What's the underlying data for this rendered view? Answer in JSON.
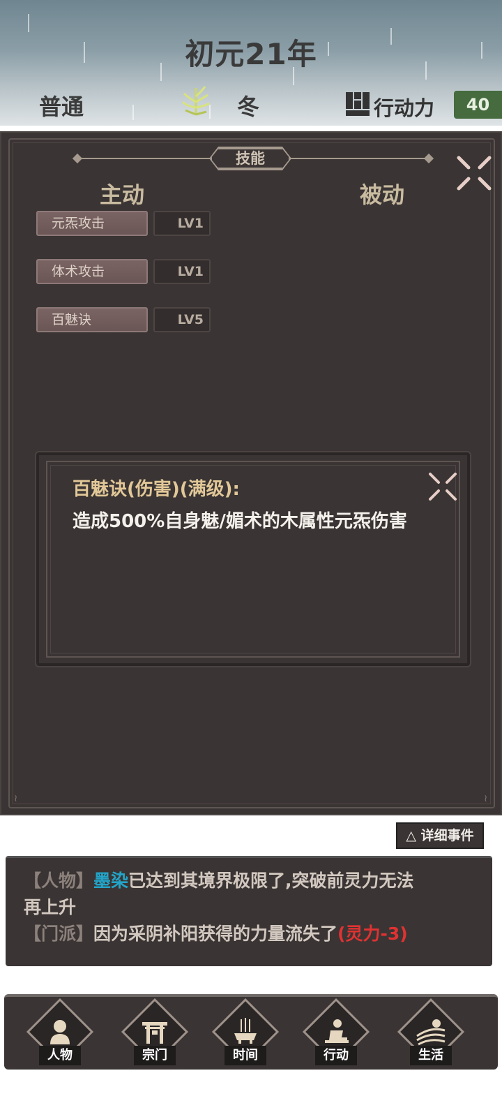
{
  "header": {
    "year": "初元21年",
    "difficulty": "普通",
    "season_icon": "reed-icon",
    "season": "冬",
    "action_points_label": "行动力",
    "action_points_value": "40"
  },
  "skills": {
    "tab_title": "技能",
    "active_heading": "主动",
    "passive_heading": "被动",
    "active_list": [
      {
        "name": "元炁攻击",
        "level": "LV1"
      },
      {
        "name": "体术攻击",
        "level": "LV1"
      },
      {
        "name": "百魅诀",
        "level": "LV5"
      }
    ],
    "detail": {
      "title": "百魅诀(伤害)(满级):",
      "text": "造成500%自身魅/媚术的木属性元炁伤害"
    }
  },
  "events": {
    "detail_button": "△ 详细事件",
    "lines": [
      {
        "tag": "【人物】",
        "name": "墨染",
        "text": "已达到其境界极限了,突破前灵力无法再上升"
      },
      {
        "tag": "【门派】",
        "text": "因为采阴补阳获得的力量流失了",
        "effect": "(灵力-3)"
      }
    ],
    "line1_wrap_a": "已达到其境界极限了,突破前灵力无法",
    "line1_wrap_b": "再上升"
  },
  "nav": [
    {
      "label": "人物",
      "icon": "person-icon"
    },
    {
      "label": "宗门",
      "icon": "sect-gate-icon"
    },
    {
      "label": "时间",
      "icon": "incense-icon"
    },
    {
      "label": "行动",
      "icon": "action-icon"
    },
    {
      "label": "生活",
      "icon": "field-icon"
    }
  ],
  "colors": {
    "panel": "#3a3534",
    "ap_badge": "#456b3e",
    "highlight_name": "#23a4c8",
    "effect_red": "#e03232"
  }
}
